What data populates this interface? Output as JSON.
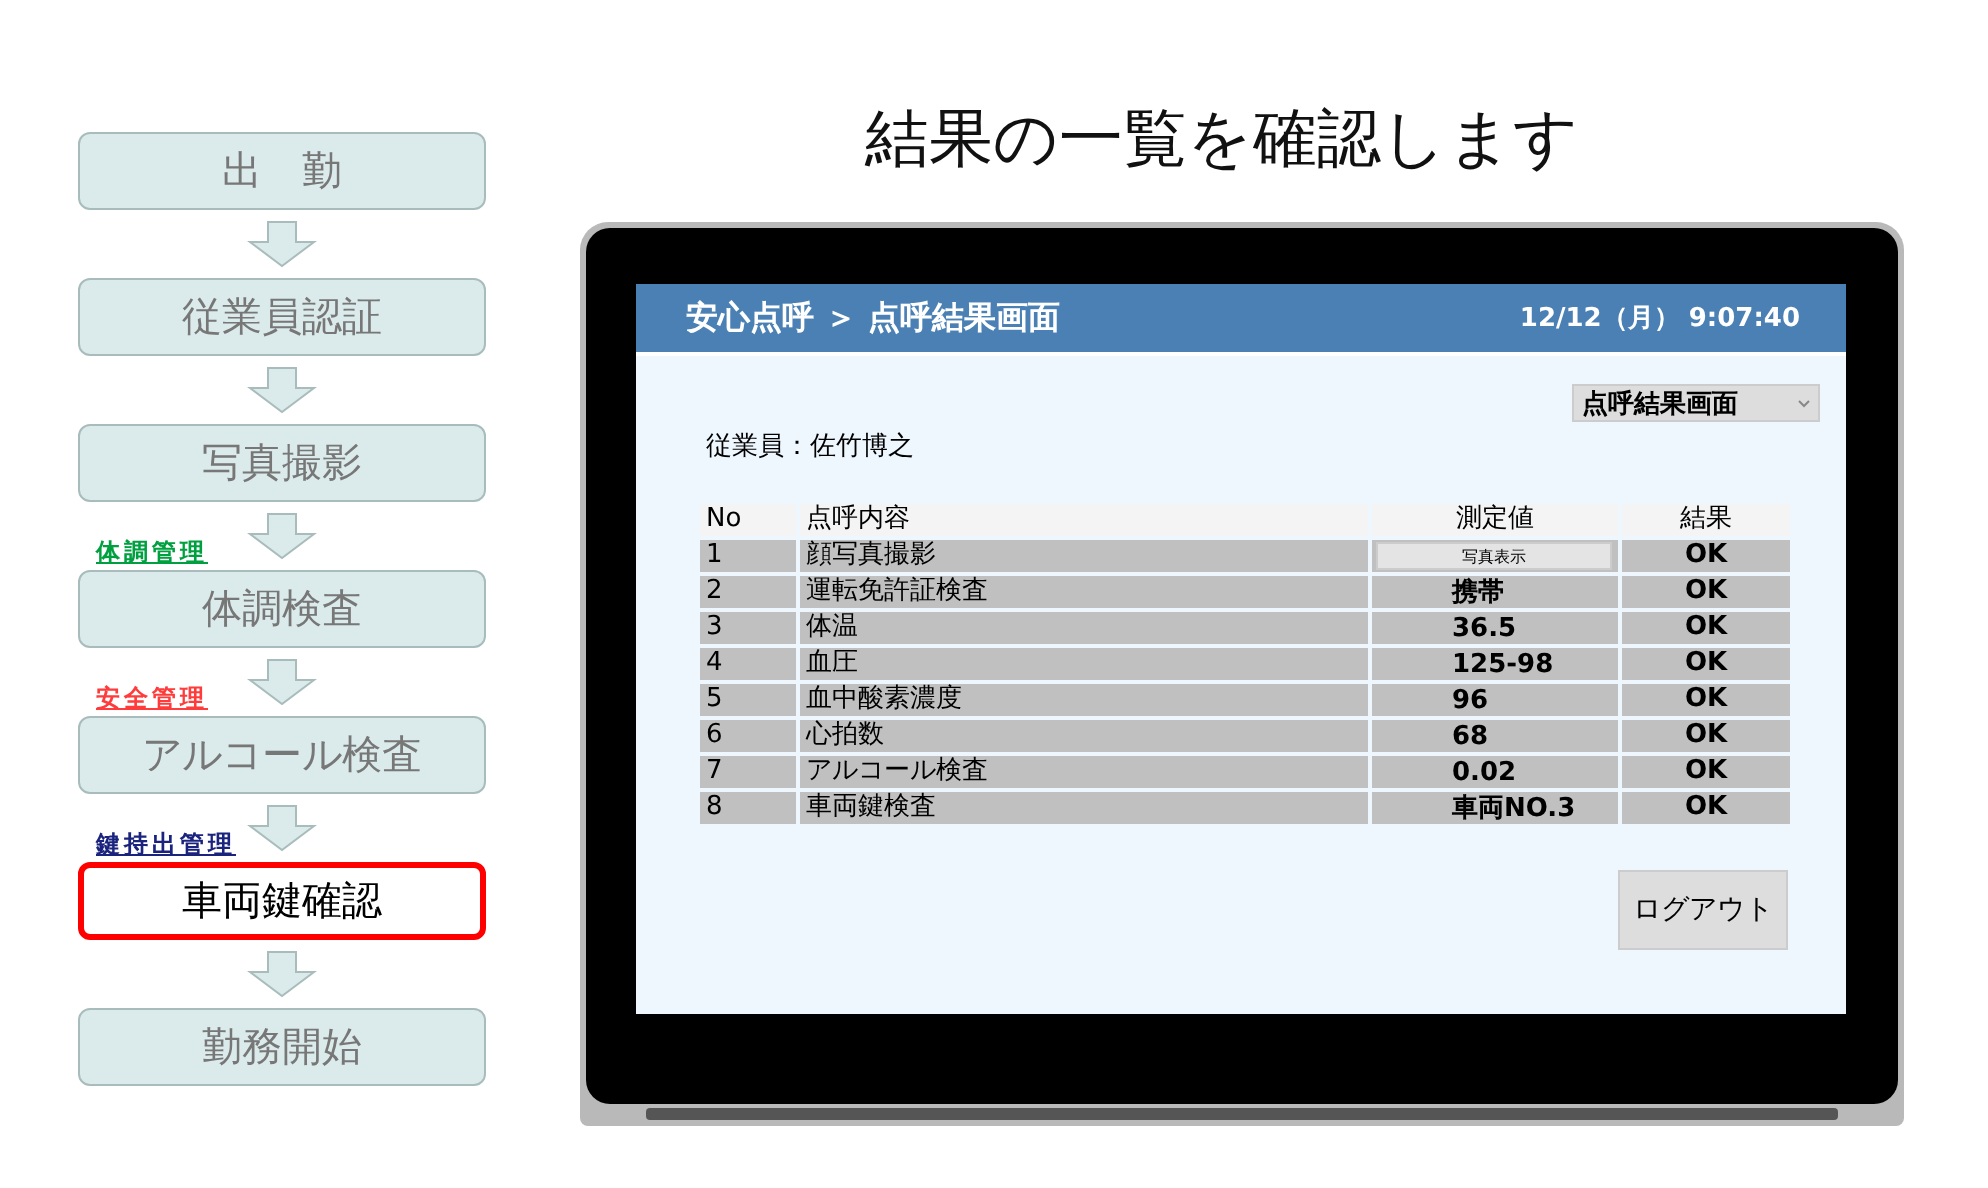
{
  "flow": {
    "steps": [
      {
        "label": "出　勤",
        "selected": false
      },
      {
        "label": "従業員認証",
        "selected": false
      },
      {
        "label": "写真撮影",
        "selected": false
      },
      {
        "label": "体調検査",
        "selected": false,
        "tag": {
          "text": "体調管理",
          "color": "#00a040"
        }
      },
      {
        "label": "アルコール検査",
        "selected": false,
        "tag": {
          "text": "安全管理",
          "color": "#ff3b3b"
        }
      },
      {
        "label": "車両鍵確認",
        "selected": true,
        "tag": {
          "text": "鍵持出管理",
          "color": "#1a237e"
        }
      },
      {
        "label": "勤務開始",
        "selected": false
      }
    ]
  },
  "heading": "結果の一覧を確認します",
  "app": {
    "breadcrumb": "安心点呼 ＞ 点呼結果画面",
    "datetime": "12/12（月） 9:07:40",
    "view_select": "点呼結果画面",
    "employee": "従業員：佐竹博之",
    "table": {
      "columns": [
        "No",
        "点呼内容",
        "測定値",
        "結果"
      ],
      "rows": [
        {
          "no": "1",
          "item": "顔写真撮影",
          "value": {
            "kind": "button",
            "text": "写真表示"
          },
          "result": "OK"
        },
        {
          "no": "2",
          "item": "運転免許証検査",
          "value": {
            "kind": "text",
            "text": "携帯"
          },
          "result": "OK"
        },
        {
          "no": "3",
          "item": "体温",
          "value": {
            "kind": "text",
            "text": "36.5"
          },
          "result": "OK"
        },
        {
          "no": "4",
          "item": "血圧",
          "value": {
            "kind": "text",
            "text": "125-98"
          },
          "result": "OK"
        },
        {
          "no": "5",
          "item": "血中酸素濃度",
          "value": {
            "kind": "text",
            "text": "96"
          },
          "result": "OK"
        },
        {
          "no": "6",
          "item": "心拍数",
          "value": {
            "kind": "text",
            "text": "68"
          },
          "result": "OK"
        },
        {
          "no": "7",
          "item": "アルコール検査",
          "value": {
            "kind": "text",
            "text": "0.02"
          },
          "result": "OK"
        },
        {
          "no": "8",
          "item": "車両鍵検査",
          "value": {
            "kind": "text",
            "text": "車両NO.3"
          },
          "result": "OK"
        }
      ]
    },
    "logout": "ログアウト"
  }
}
